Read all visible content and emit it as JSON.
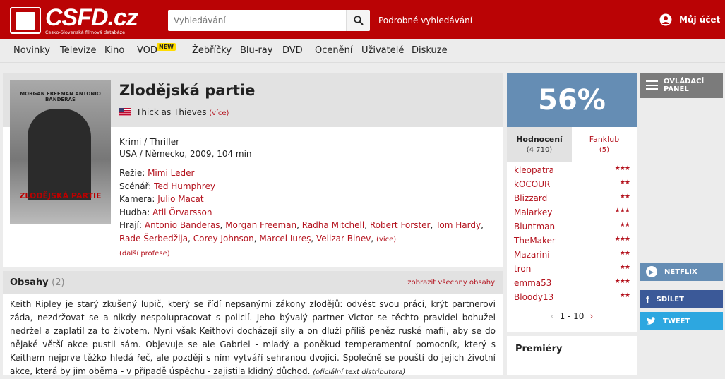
{
  "header": {
    "logo_text": "CSFD.cz",
    "logo_sub": "Česko-Slovenská filmová databáze",
    "search_placeholder": "Vyhledávání",
    "advanced_search": "Podrobné vyhledávání",
    "account": "Můj účet"
  },
  "menu": {
    "items": [
      "Novinky",
      "Televize",
      "Kino",
      "VOD",
      "Žebříčky",
      "Blu-ray",
      "DVD",
      "Ocenění",
      "Uživatelé",
      "Diskuze"
    ],
    "new_badge": "NEW"
  },
  "film": {
    "title": "Zlodějská partie",
    "alt_title": "Thick as Thieves",
    "more": "(více)",
    "poster_names": "MORGAN FREEMAN   ANTONIO BANDERAS",
    "poster_title": "ZLODĚJSKÁ PARTIE",
    "genre": "Krimi / Thriller",
    "origin": "USA / Německo, 2009, 104 min",
    "credits": {
      "director_label": "Režie:",
      "director": "Mimi Leder",
      "writer_label": "Scénář:",
      "writer": "Ted Humphrey",
      "camera_label": "Kamera:",
      "camera": "Julio Macat",
      "music_label": "Hudba:",
      "music": "Atli Örvarsson",
      "cast_label": "Hrají:",
      "cast": [
        "Antonio Banderas",
        "Morgan Freeman",
        "Radha Mitchell",
        "Robert Forster",
        "Tom Hardy",
        "Rade Šerbedžija",
        "Corey Johnson",
        "Marcel Iureș",
        "Velizar Binev"
      ],
      "cast_more": "(více)",
      "more_professions": "(další profese)"
    }
  },
  "plot": {
    "title": "Obsahy",
    "count": "(2)",
    "show_all": "zobrazit všechny obsahy",
    "text": "Keith Ripley je starý zkušený lupič, který se řídí nepsanými zákony zlodějů: odvést svou práci, krýt partnerovi záda, nezdržovat se a nikdy nespolupracovat s policií. Jeho bývalý partner Victor se těchto pravidel bohužel nedržel a zaplatil za to životem. Nyní však Keithovi docházejí síly a on dluží příliš peněz ruské mafii, aby se do nějaké větší akce pustil sám. Objevuje se ale Gabriel - mladý a poněkud temperamentní pomocník, který s Keithem nejprve těžko hledá řeč, ale později s ním vytváří sehranou dvojici. Společně se pouští do jejich životní akce, která by jim oběma - v případě úspěchu - zajistila klidný důchod.",
    "source": "(oficiální text distributora)"
  },
  "rating": {
    "score": "56%",
    "tab_ratings": "Hodnocení",
    "tab_ratings_count": "(4 710)",
    "tab_fanclub": "Fanklub",
    "tab_fanclub_count": "(5)",
    "users": [
      {
        "name": "kleopatra",
        "stars": "★★★"
      },
      {
        "name": "kOCOUR",
        "stars": "★★"
      },
      {
        "name": "Blizzard",
        "stars": "★★"
      },
      {
        "name": "Malarkey",
        "stars": "★★★"
      },
      {
        "name": "Bluntman",
        "stars": "★★"
      },
      {
        "name": "TheMaker",
        "stars": "★★★"
      },
      {
        "name": "Mazarini",
        "stars": "★★"
      },
      {
        "name": "tron",
        "stars": "★★"
      },
      {
        "name": "emma53",
        "stars": "★★★"
      },
      {
        "name": "Bloody13",
        "stars": "★★"
      }
    ],
    "pager": "1 - 10"
  },
  "premiery": "Premiéry",
  "side": {
    "control_line1": "OVLÁDACÍ",
    "control_line2": "PANEL",
    "netflix": "NETFLIX",
    "share": "SDÍLET",
    "tweet": "TWEET"
  },
  "colors": {
    "brand": "#ba0305",
    "link": "#b4131e",
    "score_bg": "#658db4"
  }
}
